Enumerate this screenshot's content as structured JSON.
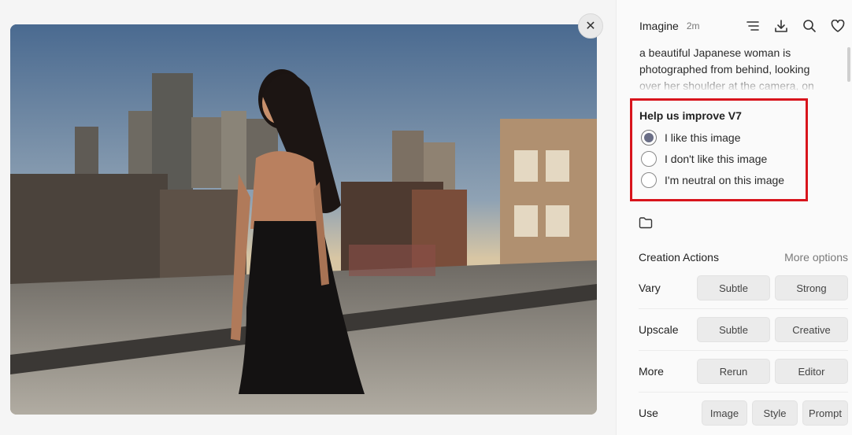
{
  "header": {
    "title": "Imagine",
    "time": "2m",
    "icons": [
      "list-icon",
      "download-icon",
      "search-icon",
      "heart-icon"
    ]
  },
  "prompt": {
    "text": "a beautiful Japanese woman is photographed from behind, looking over her shoulder at the camera, on a"
  },
  "feedback": {
    "title": "Help us improve V7",
    "options": [
      {
        "label": "I like this image",
        "checked": true
      },
      {
        "label": "I don't like this image",
        "checked": false
      },
      {
        "label": "I'm neutral on this image",
        "checked": false
      }
    ]
  },
  "creation": {
    "title": "Creation Actions",
    "more": "More options",
    "rows": [
      {
        "label": "Vary",
        "buttons": [
          "Subtle",
          "Strong"
        ]
      },
      {
        "label": "Upscale",
        "buttons": [
          "Subtle",
          "Creative"
        ]
      },
      {
        "label": "More",
        "buttons": [
          "Rerun",
          "Editor"
        ]
      },
      {
        "label": "Use",
        "buttons": [
          "Image",
          "Style",
          "Prompt"
        ]
      }
    ]
  },
  "icons": {
    "close": "close-icon",
    "folder": "folder-icon"
  },
  "colors": {
    "highlight_border": "#d8141c",
    "radio_checked": "#6a6e86",
    "button_bg": "#ebebeb"
  }
}
